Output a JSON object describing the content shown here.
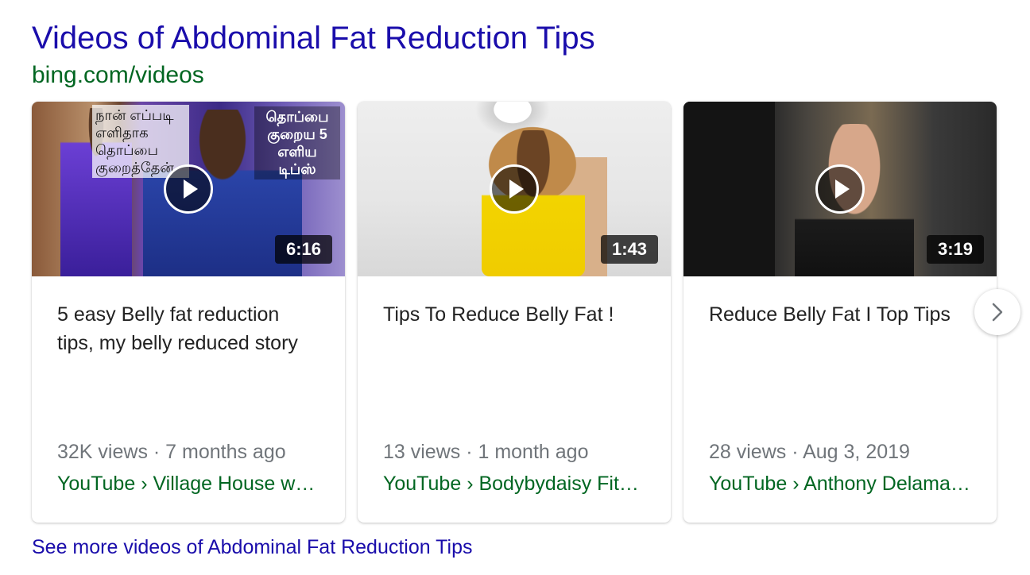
{
  "header": {
    "title": "Videos of Abdominal Fat Reduction Tips",
    "source": "bing.com/videos"
  },
  "videos": [
    {
      "duration": "6:16",
      "overlay_left": "நான் எப்படி எளிதாக தொப்பை குறைத்தேன்",
      "overlay_right": "தொப்பை குறைய 5 எளிய டிப்ஸ்",
      "title": "5 easy Belly fat reduction tips, my belly reduced story",
      "meta": "32K views · 7 months ago",
      "channel": "YouTube › Village House w…"
    },
    {
      "duration": "1:43",
      "title": "Tips To Reduce Belly Fat !",
      "meta": "13 views · 1 month ago",
      "channel": "YouTube › Bodybydaisy Fit…"
    },
    {
      "duration": "3:19",
      "title": "Reduce Belly Fat I Top Tips",
      "meta": "28 views · Aug 3, 2019",
      "channel": "YouTube › Anthony Delama…"
    }
  ],
  "next_icon": "chevron-right-icon",
  "see_more": "See more videos of Abdominal Fat Reduction Tips",
  "colors": {
    "link": "#1a0dab",
    "source_green": "#006621",
    "meta_gray": "#70757a"
  }
}
